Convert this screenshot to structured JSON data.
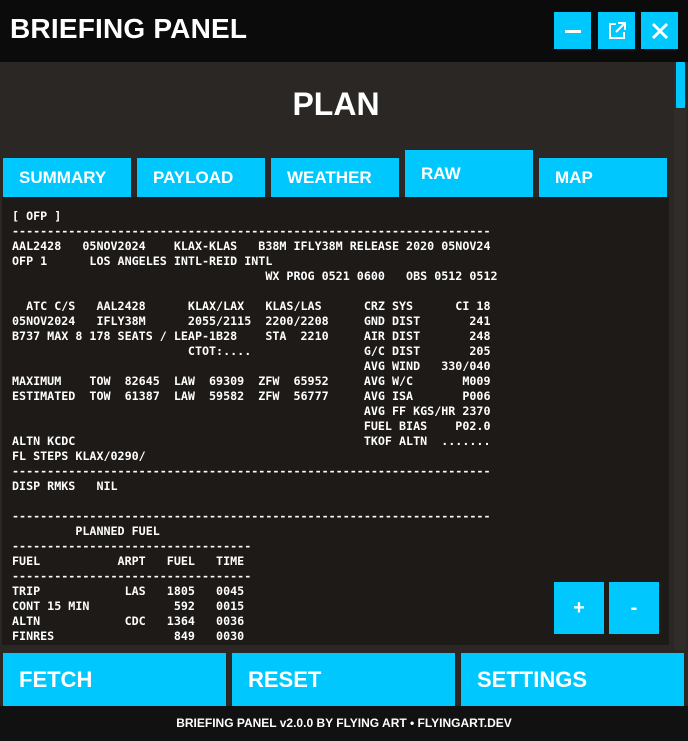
{
  "app": {
    "title": "BRIEFING PANEL",
    "accent_color": "#00c8ff",
    "window_buttons": [
      {
        "icon": "minimize-icon"
      },
      {
        "icon": "popout-icon"
      },
      {
        "icon": "close-icon"
      }
    ]
  },
  "page": {
    "heading": "PLAN"
  },
  "tabs": [
    {
      "label": "SUMMARY",
      "active": false
    },
    {
      "label": "PAYLOAD",
      "active": false
    },
    {
      "label": "WEATHER",
      "active": false
    },
    {
      "label": "RAW",
      "active": true
    },
    {
      "label": "MAP",
      "active": false
    }
  ],
  "ofp": {
    "lines": [
      "[ OFP ]",
      "--------------------------------------------------------------------",
      "AAL2428   05NOV2024    KLAX-KLAS   B38M IFLY38M RELEASE 2020 05NOV24",
      "OFP 1      LOS ANGELES INTL-REID INTL",
      "                                    WX PROG 0521 0600   OBS 0512 0512",
      "",
      "  ATC C/S   AAL2428      KLAX/LAX   KLAS/LAS      CRZ SYS      CI 18",
      "05NOV2024   IFLY38M      2055/2115  2200/2208     GND DIST       241",
      "B737 MAX 8 178 SEATS / LEAP-1B28    STA  2210     AIR DIST       248",
      "                         CTOT:....                G/C DIST       205",
      "                                                  AVG WIND   330/040",
      "MAXIMUM    TOW  82645  LAW  69309  ZFW  65952     AVG W/C       M009",
      "ESTIMATED  TOW  61387  LAW  59582  ZFW  56777     AVG ISA       P006",
      "                                                  AVG FF KGS/HR 2370",
      "                                                  FUEL BIAS    P02.0",
      "ALTN KCDC                                         TKOF ALTN  .......",
      "FL STEPS KLAX/0290/",
      "--------------------------------------------------------------------",
      "DISP RMKS   NIL",
      "",
      "--------------------------------------------------------------------",
      "         PLANNED FUEL",
      "----------------------------------",
      "FUEL           ARPT   FUEL   TIME",
      "----------------------------------",
      "TRIP            LAS   1805   0045",
      "CONT 15 MIN            592   0015",
      "ALTN            CDC   1364   0036",
      "FINRES                 849   0030"
    ]
  },
  "zoom": {
    "in_label": "+",
    "out_label": "-"
  },
  "actions": {
    "fetch_label": "FETCH",
    "reset_label": "RESET",
    "settings_label": "SETTINGS"
  },
  "footer": {
    "text": "BRIEFING PANEL v2.0.0 BY FLYING ART • FLYINGART.DEV"
  }
}
